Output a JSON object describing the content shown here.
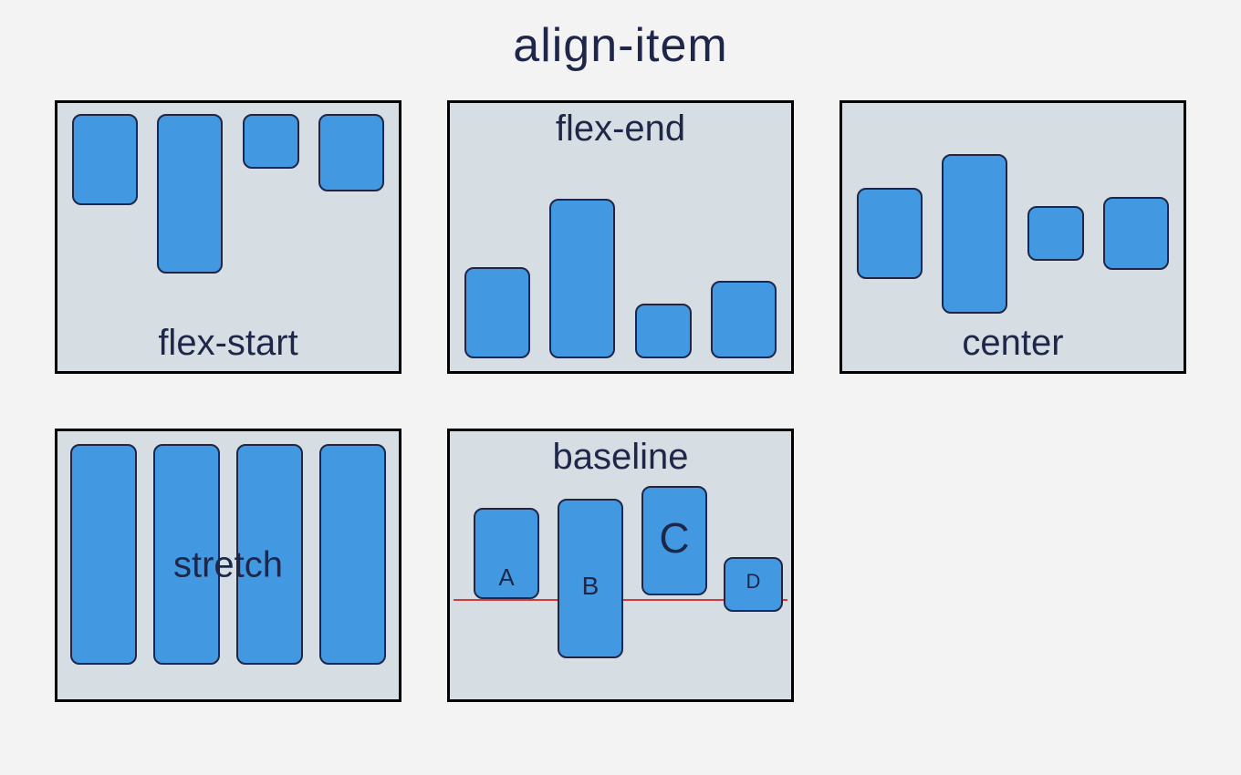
{
  "title": "align-item",
  "panels": {
    "flex_start": {
      "label": "flex-start"
    },
    "flex_end": {
      "label": "flex-end"
    },
    "center": {
      "label": "center"
    },
    "stretch": {
      "label": "stretch"
    },
    "baseline": {
      "label": "baseline",
      "items": {
        "a": "A",
        "b": "B",
        "c": "C",
        "d": "D"
      }
    }
  }
}
